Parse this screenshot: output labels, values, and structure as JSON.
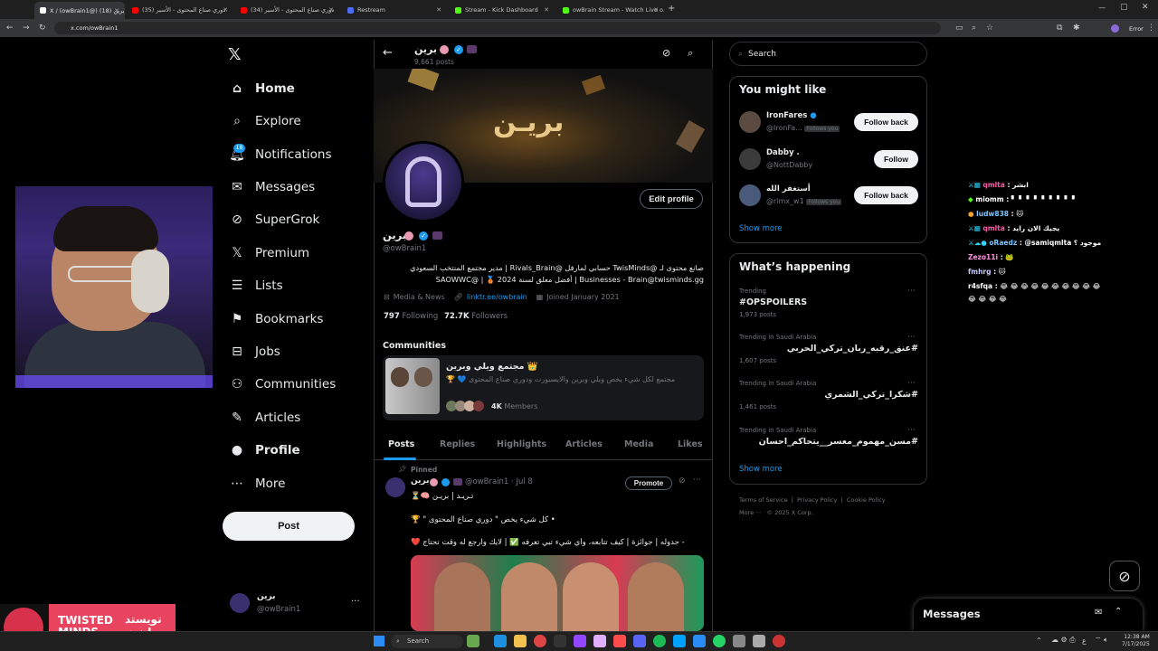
{
  "browser": {
    "tabs": [
      {
        "label": "X / (owBrain1@) برين (18)",
        "active": true,
        "color": "#ffffff"
      },
      {
        "label": "(35) دوري صناع المحتوى - الأسير",
        "active": false,
        "color": "#ff0000"
      },
      {
        "label": "(34) دوري صناع المحتوى - الأسير",
        "active": false,
        "color": "#ff0000"
      },
      {
        "label": "Restream",
        "active": false,
        "color": "#4a6cf7"
      },
      {
        "label": "Stream - Kick Dashboard",
        "active": false,
        "color": "#53fc18"
      },
      {
        "label": "owBrain Stream - Watch Live o...",
        "active": false,
        "color": "#53fc18"
      }
    ],
    "url": "x.com/owBrain1",
    "error_label": "Error"
  },
  "brand": {
    "name_en_1": "TWISTED",
    "name_en_2": "MINDS",
    "name_ar_1": "تويستد",
    "name_ar_2": "مايندز"
  },
  "nav": {
    "items": [
      {
        "label": "Home",
        "icon": "home-icon"
      },
      {
        "label": "Explore",
        "icon": "search-icon"
      },
      {
        "label": "Notifications",
        "icon": "bell-icon"
      },
      {
        "label": "Messages",
        "icon": "mail-icon"
      },
      {
        "label": "SuperGrok",
        "icon": "grok-icon"
      },
      {
        "label": "Premium",
        "icon": "x-icon"
      },
      {
        "label": "Lists",
        "icon": "list-icon"
      },
      {
        "label": "Bookmarks",
        "icon": "bookmark-icon"
      },
      {
        "label": "Jobs",
        "icon": "briefcase-icon"
      },
      {
        "label": "Communities",
        "icon": "people-icon"
      },
      {
        "label": "Articles",
        "icon": "article-icon"
      },
      {
        "label": "Profile",
        "icon": "person-icon"
      },
      {
        "label": "More",
        "icon": "more-icon"
      }
    ],
    "notif_count": "18",
    "post_label": "Post",
    "account_name": "برين",
    "account_handle": "@owBrain1"
  },
  "profile": {
    "header_name": "برين",
    "post_count": "9,661 posts",
    "banner_text": "بريـن",
    "name": "برين",
    "handle": "@owBrain1",
    "edit_label": "Edit profile",
    "bio_line1": "صانع محتوى لـ @TwisMinds حسابي لمارفل @Rivals_Brain | مدير مجتمع المنتخب السعودي",
    "bio_line2": "Businesses - Brain@twisminds.gg | أفضل معلق لسنة 2024 🥉 | @SAOWWC",
    "category": "Media & News",
    "link": "linktr.ee/owbrain",
    "joined": "Joined January 2021",
    "following_count": "797",
    "following_label": "Following",
    "followers_count": "72.7K",
    "followers_label": "Followers",
    "communities_label": "Communities",
    "community_name": "مجتمع ويلي وبرين 👑",
    "community_desc": "مجتمع لكل شيء يخص ويلي وبرين والايسبورت ودوري صناع المحتوى 💙 🏆",
    "community_members_count": "4K",
    "community_members_label": "Members",
    "tabs": [
      "Posts",
      "Replies",
      "Highlights",
      "Articles",
      "Media",
      "Likes"
    ]
  },
  "post": {
    "pinned_label": "Pinned",
    "author": "برين",
    "handle_date": "@owBrain1 · Jul 8",
    "promote_label": "Promote",
    "line1": "تـريـد | بريـن 🧠⏳",
    "line2": "• كل شيء يخص \" دوري صناع المحتوى \" 🏆",
    "line3": "- جدوله | جوائزة | كيف تتابعه، وأي شيء تبي تعرفه ✅ | لايك وارجع له وقت تحتاج ❤️"
  },
  "right": {
    "search_placeholder": "Search",
    "might_like_title": "You might like",
    "suggestions": [
      {
        "name": "IronFares",
        "handle": "@IronFa...",
        "follows_you": "Follows you",
        "button": "Follow back"
      },
      {
        "name": "Dabby .",
        "handle": "@NottDabby",
        "follows_you": "",
        "button": "Follow"
      },
      {
        "name": "أستغفر الله",
        "handle": "@rimx_w1",
        "follows_you": "Follows you",
        "button": "Follow back"
      }
    ],
    "show_more": "Show more",
    "happening_title": "What’s happening",
    "trends": [
      {
        "context": "Trending",
        "name": "#OPSPOILERS",
        "posts": "1,973 posts"
      },
      {
        "context": "Trending in Saudi Arabia",
        "name": "#عنق_رقبه_ربان_تركي_الحربي",
        "posts": "1,607 posts"
      },
      {
        "context": "Trending in Saudi Arabia",
        "name": "#شكرا_تركي_الشمري",
        "posts": "1,461 posts"
      },
      {
        "context": "Trending in Saudi Arabia",
        "name": "#مسن_مهموم_معسر__يتحاكم_احسان",
        "posts": ""
      }
    ],
    "show_more_2": "Show more",
    "footer_links": [
      "Terms of Service",
      "Privacy Policy",
      "Cookie Policy"
    ],
    "footer_more": "More ···",
    "footer_copy": "© 2025 X Corp.",
    "messages_label": "Messages"
  },
  "chat": [
    {
      "user": "qmlta",
      "text": ": ابشر",
      "color": "#ff5ca8"
    },
    {
      "user": "miomm",
      "text": ": ▘ ▘ ▘ ▘ ▘ ▘ ▘ ▘ ▘",
      "color": "#ffffff"
    },
    {
      "user": "ludw838",
      "text": ": 🐱",
      "color": "#7cc4ff"
    },
    {
      "user": "qmlta",
      "text": ": يجيك الان رايد",
      "color": "#ff5ca8"
    },
    {
      "user": "oRaedz",
      "text": ": @samiqmlta موجود ؟",
      "color": "#7cc4ff"
    },
    {
      "user": "Zezo11i",
      "text": ": 🐸",
      "color": "#ff8fe0"
    },
    {
      "user": "fmhrg",
      "text": ": 🐱",
      "color": "#c8c8ff"
    },
    {
      "user": "r4sfqa",
      "text": ": 😂 😂 😂 😂 😂 😂 😂 😂 😂 😂",
      "color": "#ffffff"
    },
    {
      "user": "",
      "text": "😂 😂 😂 😂",
      "color": "#ffffff"
    }
  ],
  "taskbar": {
    "search_label": "Search",
    "time": "12:38 AM",
    "date": "7/17/2025",
    "lang": "ع"
  }
}
